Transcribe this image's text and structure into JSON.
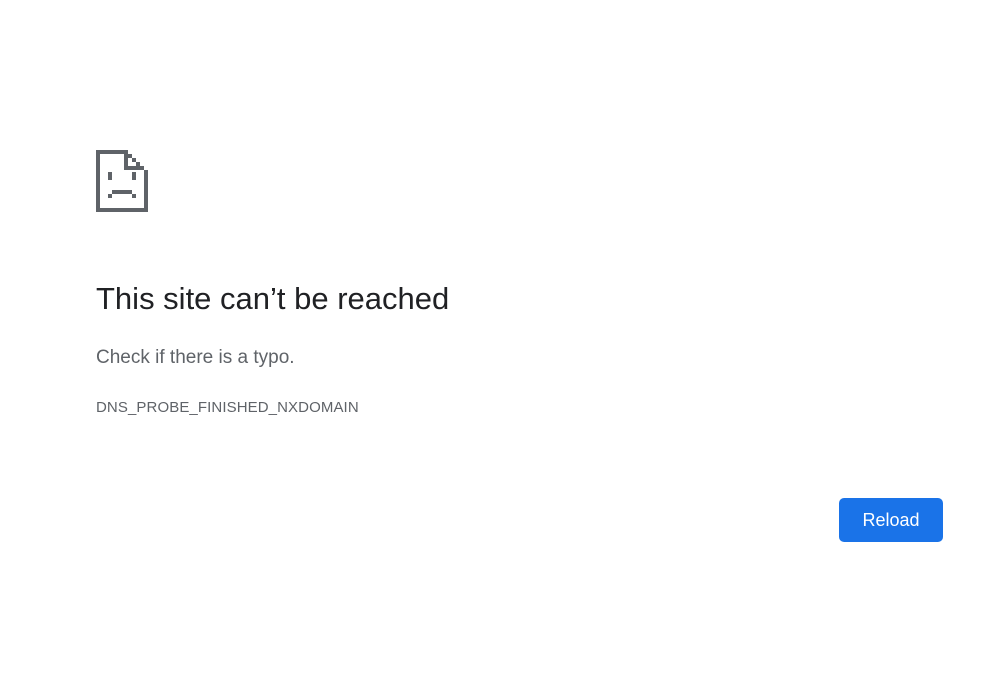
{
  "error_page": {
    "icon": "sad-document-icon",
    "title": "This site can’t be reached",
    "suggestion": "Check if there is a typo.",
    "error_code": "DNS_PROBE_FINISHED_NXDOMAIN",
    "reload_label": "Reload"
  },
  "colors": {
    "background": "#ffffff",
    "title_text": "#202124",
    "body_text": "#5f6368",
    "icon": "#5f6368",
    "button_bg": "#1a73e8",
    "button_text": "#ffffff"
  }
}
